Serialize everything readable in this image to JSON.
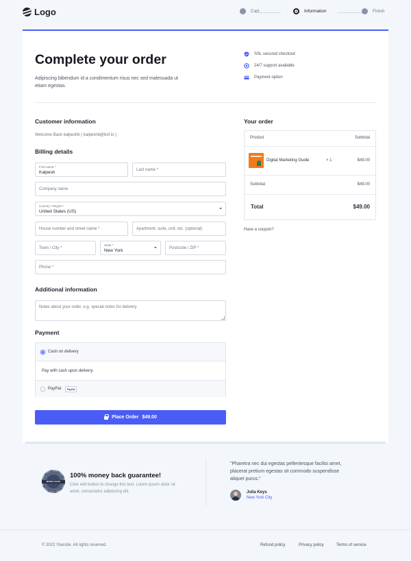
{
  "header": {
    "logo": "Logo",
    "steps": [
      {
        "label": "Cart",
        "state": "done"
      },
      {
        "label": "Information",
        "state": "active"
      },
      {
        "label": "Finish",
        "state": "todo"
      }
    ]
  },
  "main": {
    "title": "Complete your order",
    "subtitle": "Adipiscing bibendum id a condimentum risus nec sed malesuada ut etiam egestas.",
    "features": [
      {
        "icon": "shield-icon",
        "label": "SSL secured checkout"
      },
      {
        "icon": "support-icon",
        "label": "24/7 support available"
      },
      {
        "icon": "card-icon",
        "label": "Payment option"
      }
    ]
  },
  "customer": {
    "title": "Customer information",
    "welcome": "Welcome Back kalpeshb ( kalpeshb@bsf.io )"
  },
  "billing": {
    "title": "Billing details",
    "first_name_label": "First name *",
    "first_name_value": "Kalpesh",
    "last_name_placeholder": "Last name *",
    "company_placeholder": "Company name",
    "country_label": "Country / Region *",
    "country_value": "United States (US)",
    "street_placeholder": "House number and street name *",
    "apartment_placeholder": "Apartment, suite, unit, etc. (optional)",
    "city_placeholder": "Town / City *",
    "state_label": "State *",
    "state_value": "New York",
    "postcode_placeholder": "Postcode / ZIP *",
    "phone_placeholder": "Phone *"
  },
  "additional": {
    "title": "Additional information",
    "notes_placeholder": "Notes about your order, e.g. special notes for delivery."
  },
  "payment": {
    "title": "Payment",
    "cod_label": "Cash on delivery",
    "cod_description": "Pay with cash upon delivery.",
    "paypal_label": "PayPal",
    "paypal_badge": "PayPal"
  },
  "place_order": {
    "label": "Place Order",
    "amount": "$49.00"
  },
  "order": {
    "title": "Your order",
    "col_product": "Product",
    "col_subtotal": "Subtotal",
    "item_name": "Digital Marketing Guide",
    "item_qty": "× 1",
    "item_price": "$49.00",
    "subtotal_label": "Subtotal",
    "subtotal_value": "$49.00",
    "total_label": "Total",
    "total_value": "$49.00",
    "coupon": "Have a coupon?"
  },
  "guarantee": {
    "badge_text": "MONEY BACK",
    "title": "100% money back guarantee!",
    "text": "Click edit button to change this text. Lorem ipsum dolor sit amet, consectetur adipiscing elit."
  },
  "testimonial": {
    "quote": "\"Pharetra nec dui egestas pellentesque facilisi amet, placerat pretium egestas sit commodo suspendisse aliquet purus.\"",
    "author": "Julia Keys",
    "location": "New York City"
  },
  "footer": {
    "copyright": "© 2022 Yoursite. All rights reserved.",
    "links": [
      "Refund policy",
      "Privacy policy",
      "Terms of service"
    ]
  },
  "colors": {
    "accent": "#4a5cf5",
    "text_dark": "#16181f",
    "background": "#f3f6fa"
  }
}
